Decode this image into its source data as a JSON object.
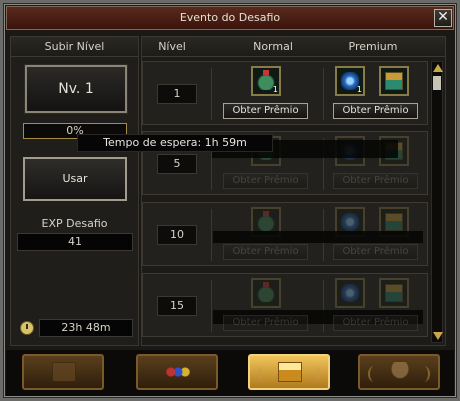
{
  "window": {
    "title": "Evento do Desafio",
    "close_label": "✕"
  },
  "left": {
    "header": "Subir Nível",
    "level_button": "Nv. 1",
    "progress_text": "0%",
    "use_button": "Usar",
    "exp_label": "EXP Desafio",
    "exp_value": "41",
    "timer": "23h 48m"
  },
  "columns": {
    "level": "Nível",
    "normal": "Normal",
    "premium": "Premium"
  },
  "rows": [
    {
      "level": "1",
      "normal_claim": "Obter Prêmio",
      "premium_claim": "Obter Prêmio",
      "normal_qty": "1",
      "premium_qty": "1"
    },
    {
      "level": "5",
      "normal_claim": "Obter Prêmio",
      "premium_claim": "Obter Prêmio"
    },
    {
      "level": "10",
      "normal_claim": "Obter Prêmio",
      "premium_claim": "Obter Prêmio"
    },
    {
      "level": "15",
      "normal_claim": "Obter Prêmio",
      "premium_claim": "Obter Prêmio"
    }
  ],
  "tooltip": "Tempo de espera: 1h 59m",
  "tabs": [
    {
      "icon": "scroll-icon",
      "active": false
    },
    {
      "icon": "gems-icon",
      "active": false
    },
    {
      "icon": "treasure-chest-icon",
      "active": true
    },
    {
      "icon": "trophy-icon",
      "active": false
    }
  ],
  "colors": {
    "accent": "#c9a64a",
    "title_bar": "#5a2a1c",
    "active_tab": "#f0c45a"
  }
}
